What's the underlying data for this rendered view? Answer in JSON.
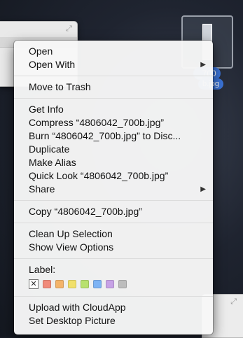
{
  "desktop": {
    "file_label_line1": "_700",
    "file_label_line2": "b.jpg"
  },
  "menu": {
    "groups": [
      [
        {
          "label": "Open"
        },
        {
          "label": "Open With",
          "submenu": true
        }
      ],
      [
        {
          "label": "Move to Trash"
        }
      ],
      [
        {
          "label": "Get Info"
        },
        {
          "label": "Compress “4806042_700b.jpg”"
        },
        {
          "label": "Burn “4806042_700b.jpg” to Disc..."
        },
        {
          "label": "Duplicate"
        },
        {
          "label": "Make Alias"
        },
        {
          "label": "Quick Look “4806042_700b.jpg”"
        },
        {
          "label": "Share",
          "submenu": true
        }
      ],
      [
        {
          "label": "Copy “4806042_700b.jpg”"
        }
      ],
      [
        {
          "label": "Clean Up Selection"
        },
        {
          "label": "Show View Options"
        }
      ]
    ],
    "label_section": {
      "title": "Label:",
      "clear_glyph": "✕",
      "colors": [
        "#f08a7a",
        "#f4b46a",
        "#f1e06a",
        "#b8e16e",
        "#7db3f4",
        "#c7a2e6",
        "#bdbdbd"
      ]
    },
    "bottom_group": [
      {
        "label": "Upload with CloudApp"
      },
      {
        "label": "Set Desktop Picture"
      }
    ],
    "submenu_glyph": "▶"
  }
}
